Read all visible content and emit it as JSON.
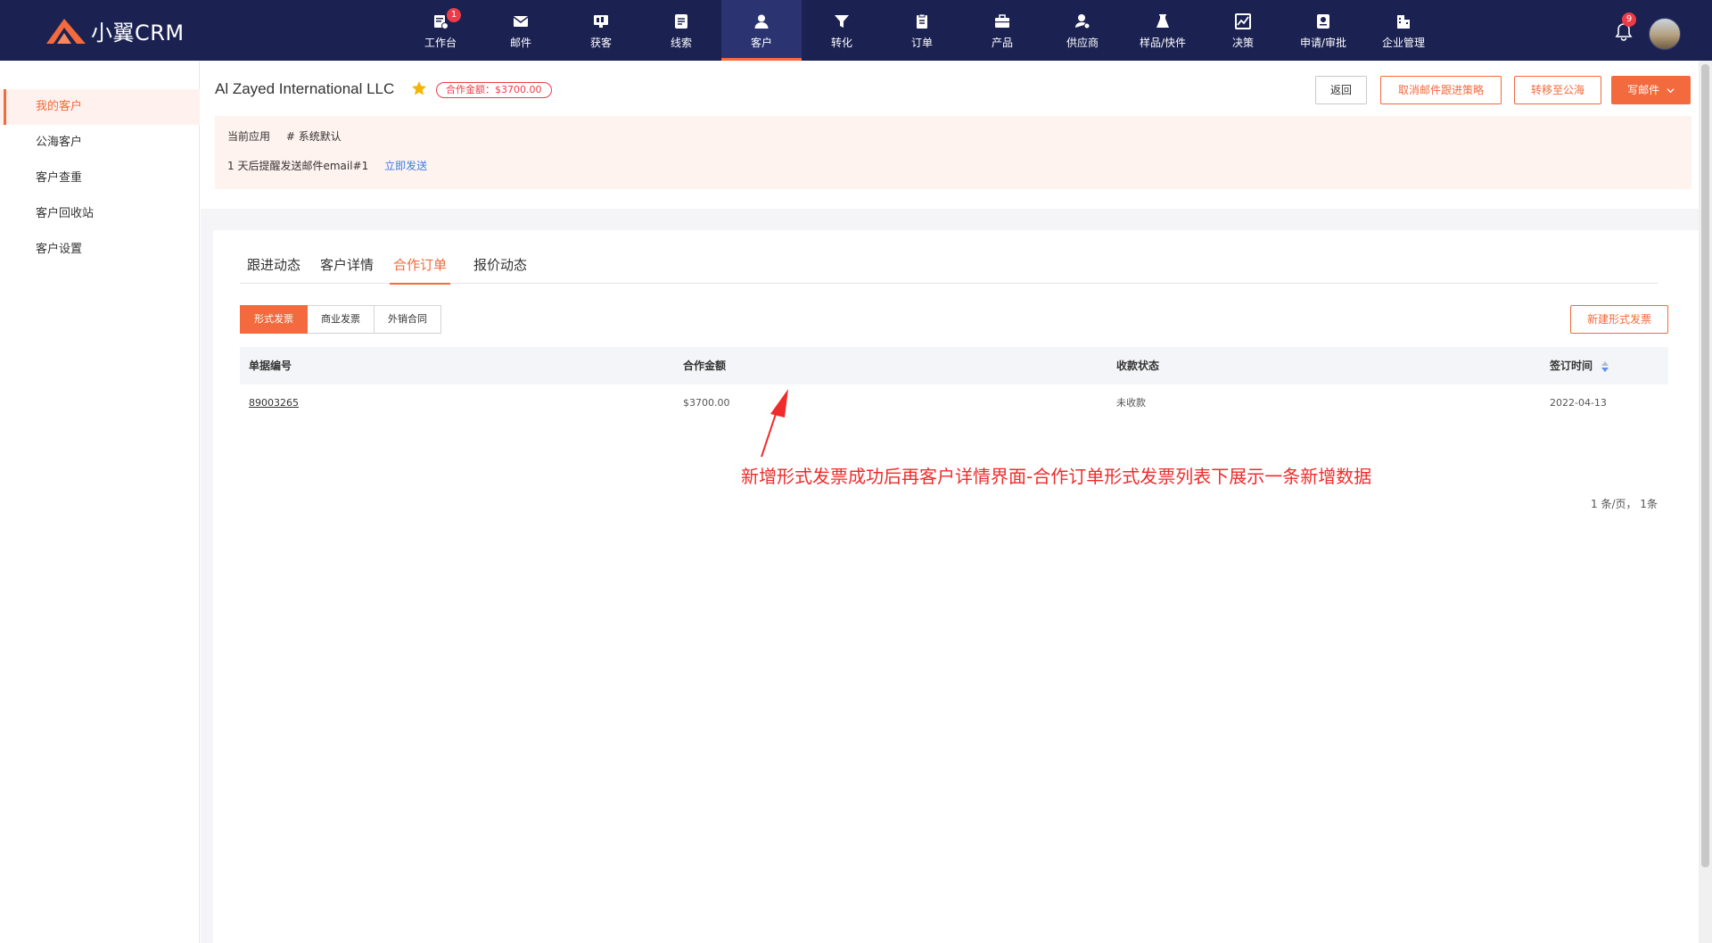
{
  "app": {
    "logo_text": "小翼CRM"
  },
  "nav": {
    "items": [
      {
        "label": "工作台",
        "icon": "workbench-icon",
        "badge": "1"
      },
      {
        "label": "邮件",
        "icon": "mail-icon"
      },
      {
        "label": "获客",
        "icon": "acquire-icon"
      },
      {
        "label": "线索",
        "icon": "leads-icon"
      },
      {
        "label": "客户",
        "icon": "customer-icon",
        "active": true
      },
      {
        "label": "转化",
        "icon": "funnel-icon"
      },
      {
        "label": "订单",
        "icon": "order-icon"
      },
      {
        "label": "产品",
        "icon": "product-icon"
      },
      {
        "label": "供应商",
        "icon": "supplier-icon"
      },
      {
        "label": "样品/快件",
        "icon": "sample-icon"
      },
      {
        "label": "决策",
        "icon": "chart-icon"
      },
      {
        "label": "申请/审批",
        "icon": "approval-icon"
      },
      {
        "label": "企业管理",
        "icon": "enterprise-icon"
      }
    ],
    "bell_badge": "9",
    "accent": "#ff6a3d",
    "bg": "#1b2252"
  },
  "sidebar": {
    "items": [
      {
        "label": "我的客户",
        "active": true
      },
      {
        "label": "公海客户"
      },
      {
        "label": "客户查重"
      },
      {
        "label": "客户回收站"
      },
      {
        "label": "客户设置"
      }
    ]
  },
  "customer": {
    "name": "Al Zayed International LLC",
    "amount_label": "合作金额：$3700.00"
  },
  "header_buttons": {
    "back": "返回",
    "cancel_strategy": "取消邮件跟进策略",
    "move_public": "转移至公海",
    "write_mail": "写邮件"
  },
  "reminder": {
    "current_app_label": "当前应用",
    "current_app_value": "# 系统默认",
    "notice": "1 天后提醒发送邮件email#1",
    "send_now": "立即发送"
  },
  "tabs": [
    "跟进动态",
    "客户详情",
    "合作订单",
    "报价动态"
  ],
  "active_tab": "合作订单",
  "segments": [
    "形式发票",
    "商业发票",
    "外销合同"
  ],
  "new_button": "新建形式发票",
  "table": {
    "columns": [
      "单据编号",
      "合作金额",
      "收款状态",
      "签订时间"
    ],
    "rows": [
      {
        "id": "89003265",
        "amount": "$3700.00",
        "status": "未收款",
        "date": "2022-04-13"
      }
    ]
  },
  "annotation": "新增形式发票成功后再客户详情界面-合作订单形式发票列表下展示一条新增数据",
  "pagination": "1 条/页，  1条",
  "colors": {
    "accent": "#f26a3d",
    "annotation_red": "#ef2b2b",
    "link_blue": "#3b7bf0"
  }
}
